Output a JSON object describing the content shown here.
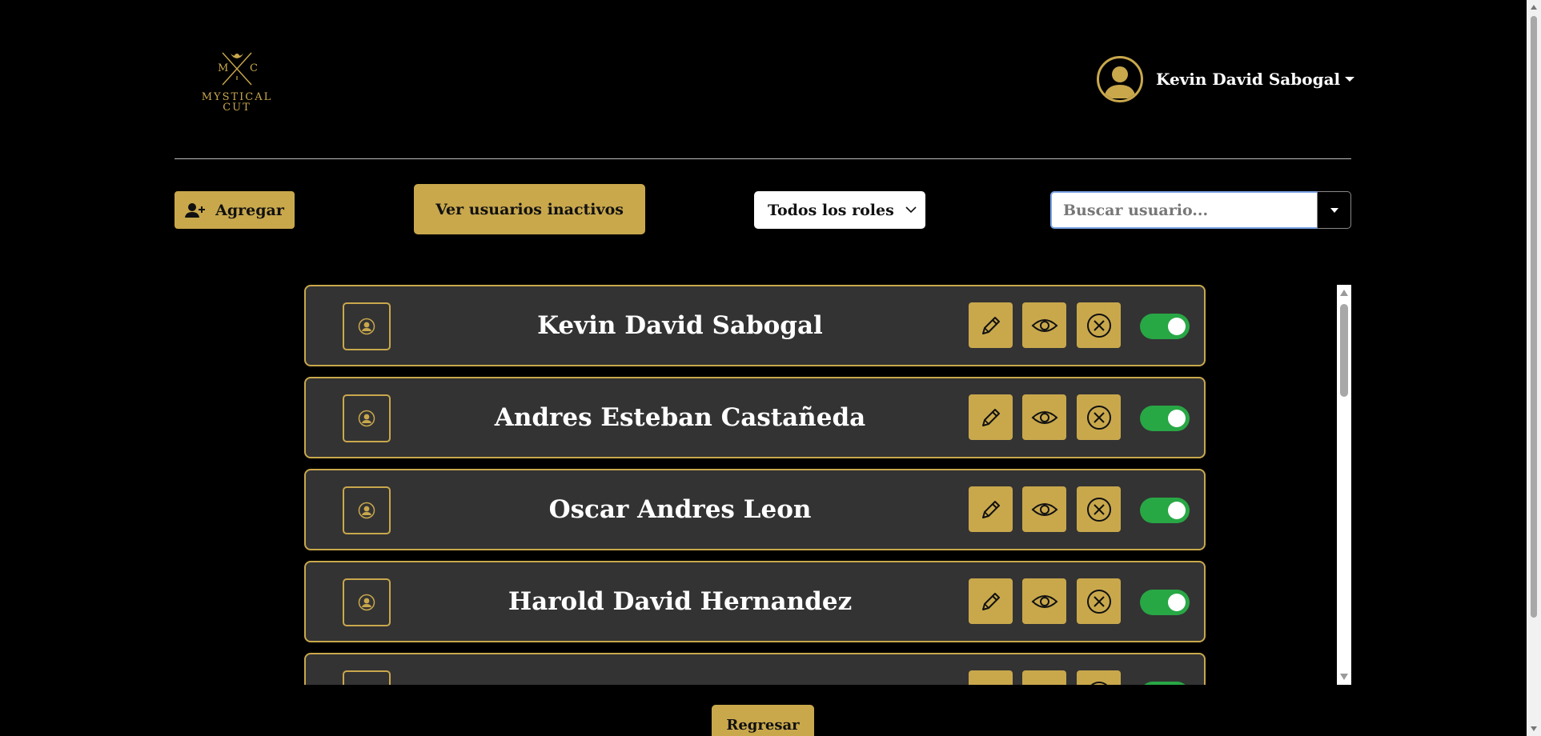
{
  "brand": {
    "monogram_left": "M",
    "monogram_right": "C",
    "line1": "MYSTICAL",
    "line2": "CUT",
    "color": "#c9a84c"
  },
  "header": {
    "user_name": "Kevin David Sabogal"
  },
  "toolbar": {
    "add_label": "Agregar",
    "inactive_label": "Ver usuarios inactivos",
    "role_filter": "Todos los roles",
    "search_placeholder": "Buscar usuario..."
  },
  "users": [
    {
      "name": "Kevin David Sabogal",
      "active": true
    },
    {
      "name": "Andres Esteban Castañeda",
      "active": true
    },
    {
      "name": "Oscar Andres Leon",
      "active": true
    },
    {
      "name": "Harold David Hernandez",
      "active": true
    },
    {
      "name": "",
      "active": true
    }
  ],
  "footer": {
    "back_label": "Regresar"
  },
  "colors": {
    "accent": "#c9a84c",
    "card_bg": "#333333",
    "toggle_on": "#28a745",
    "page_bg": "#000000"
  }
}
